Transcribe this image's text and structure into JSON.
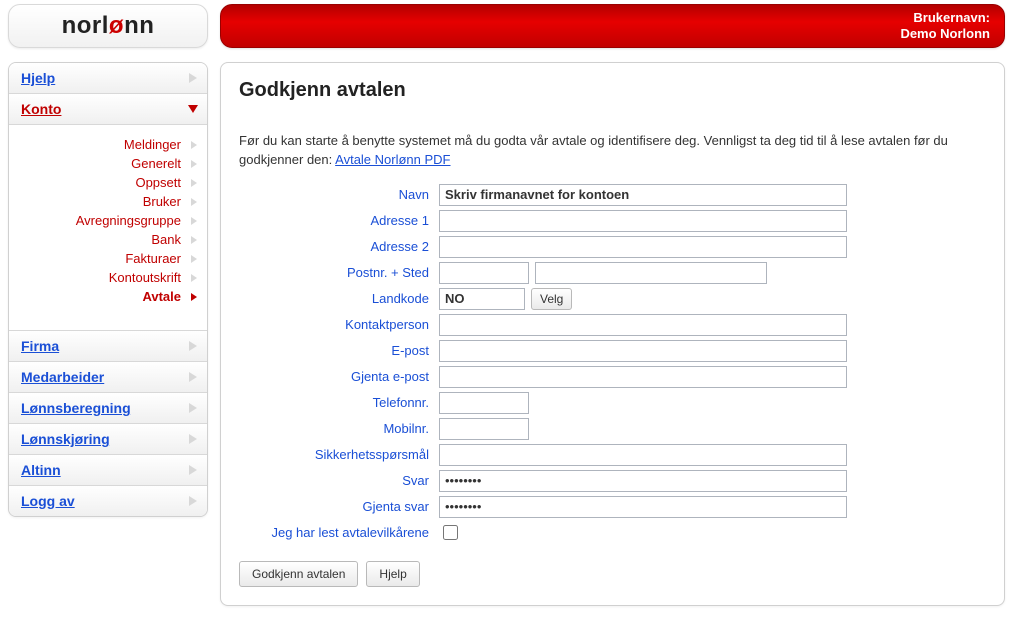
{
  "brand": {
    "name": "norlønn",
    "plain_left": "norl",
    "accent": "ø",
    "plain_right": "nn"
  },
  "banner": {
    "user_label": "Brukernavn:",
    "user_value": "Demo Norlonn"
  },
  "sidebar": {
    "items": [
      {
        "label": "Hjelp",
        "active": false
      },
      {
        "label": "Konto",
        "active": true
      },
      {
        "label": "Firma"
      },
      {
        "label": "Medarbeider"
      },
      {
        "label": "Lønnsberegning"
      },
      {
        "label": "Lønnskjøring"
      },
      {
        "label": "Altinn"
      },
      {
        "label": "Logg av"
      }
    ],
    "sub": [
      {
        "label": "Meldinger"
      },
      {
        "label": "Generelt"
      },
      {
        "label": "Oppsett"
      },
      {
        "label": "Bruker"
      },
      {
        "label": "Avregningsgruppe"
      },
      {
        "label": "Bank"
      },
      {
        "label": "Fakturaer"
      },
      {
        "label": "Kontoutskrift"
      },
      {
        "label": "Avtale",
        "current": true
      }
    ]
  },
  "page": {
    "title": "Godkjenn avtalen",
    "intro_before": "Før du kan starte å benytte systemet må du godta vår avtale og identifisere deg. Vennligst ta deg tid til å lese avtalen før du godkjenner den: ",
    "intro_link": "Avtale Norlønn PDF"
  },
  "form": {
    "labels": {
      "navn": "Navn",
      "adresse1": "Adresse 1",
      "adresse2": "Adresse 2",
      "postnr": "Postnr. + Sted",
      "landkode": "Landkode",
      "velg": "Velg",
      "kontaktperson": "Kontaktperson",
      "epost": "E-post",
      "gjenta_epost": "Gjenta e-post",
      "telefon": "Telefonnr.",
      "mobil": "Mobilnr.",
      "sikkerhet": "Sikkerhetsspørsmål",
      "svar": "Svar",
      "gjenta_svar": "Gjenta svar",
      "vilkar": "Jeg har lest avtalevilkårene"
    },
    "values": {
      "navn": "Skriv firmanavnet for kontoen",
      "adresse1": "",
      "adresse2": "",
      "postnr": "",
      "sted": "",
      "landkode": "NO",
      "kontaktperson": "",
      "epost": "",
      "gjenta_epost": "",
      "telefon": "",
      "mobil": "",
      "sikkerhet": "",
      "svar": "••••••••",
      "gjenta_svar": "••••••••",
      "vilkar_checked": false
    },
    "buttons": {
      "godkjenn": "Godkjenn avtalen",
      "hjelp": "Hjelp"
    }
  }
}
